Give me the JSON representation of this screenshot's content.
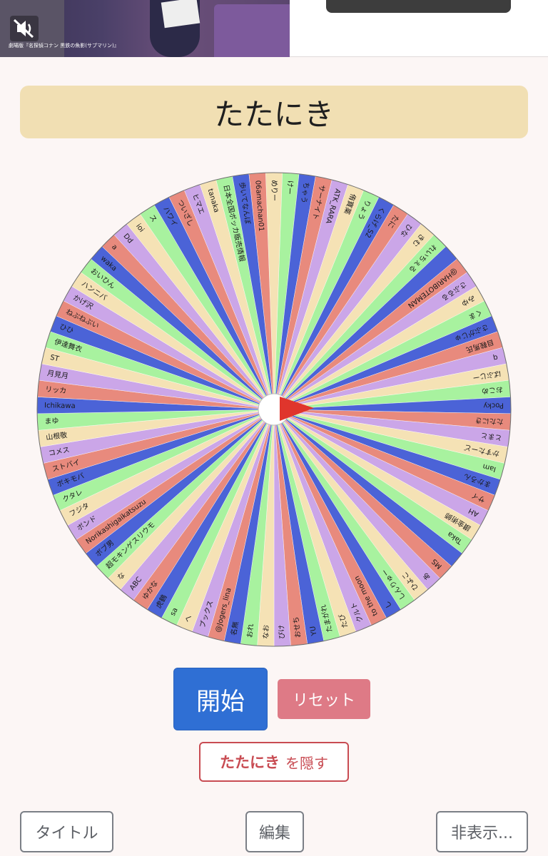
{
  "video": {
    "caption": "劇場版『名探偵コナン 黒鉄の魚影(サブマリン)』"
  },
  "title": "たたにき",
  "wheel": {
    "colors": [
      "#f5e2b5",
      "#a8f29f",
      "#4b63d7",
      "#e88a7d",
      "#cba6e8"
    ],
    "names": [
      "めりー",
      "けー",
      "ちゃう",
      "サーナイト",
      "ATK_RARA",
      "侑寶薬",
      "りょう",
      "くらげ_S2",
      "たに",
      "ひな",
      "きむ",
      "れいちぇる",
      "",
      "@HARIBOTEMAN",
      "さぶるる",
      "みゆ",
      "くま",
      "さぶがじゅ",
      "目鞍馬氏",
      "q",
      "ばぶじー",
      "おこめ",
      "Pocky",
      "たたにき",
      "とまと",
      "かすたーど",
      "Iam",
      "まかろん",
      "サイ",
      "AH",
      "讃金術師",
      "Taka",
      "",
      "MS",
      "あ",
      "ひよこ",
      "しんりゅー",
      "し",
      "to the moon",
      "クルト",
      "たび",
      "たまがれ",
      "YU",
      "おせち",
      "ぴけ",
      "なお",
      "おれ",
      "名無",
      "@Jogers_lina",
      "ブックス",
      "へ",
      "sa",
      "虎鶴",
      "ゆかな",
      "ABC",
      "な",
      "超モキンゲスリウモ",
      "ボブ男",
      "Norikashigaikatsuzu",
      "ボンド",
      "フジタ",
      "クタレ",
      "ボキモバ",
      "ストバイ",
      "コメス",
      "山根敬",
      "まゆ",
      "Ichikawa",
      "リッカ",
      "月見月",
      "ST",
      "伊達舞衣",
      "ひひ",
      "ねぶねぶい",
      "かげ沢",
      "ハンニバ",
      "おいひん",
      "waka",
      "a",
      "Dd",
      "ioi",
      "ス",
      "ハワイ",
      "ついざし",
      "ヒマエ",
      "tanaka",
      "日本全国ボッカ販売情報",
      "歩いてなんぼ",
      "06amachan01"
    ]
  },
  "actions": {
    "start": "開始",
    "reset": "リセット",
    "hide_name": "たたにき",
    "hide_suffix": "を隠す"
  },
  "footer": {
    "title_button": "タイトル",
    "edit_button": "編集",
    "hidden_button": "非表示..."
  }
}
